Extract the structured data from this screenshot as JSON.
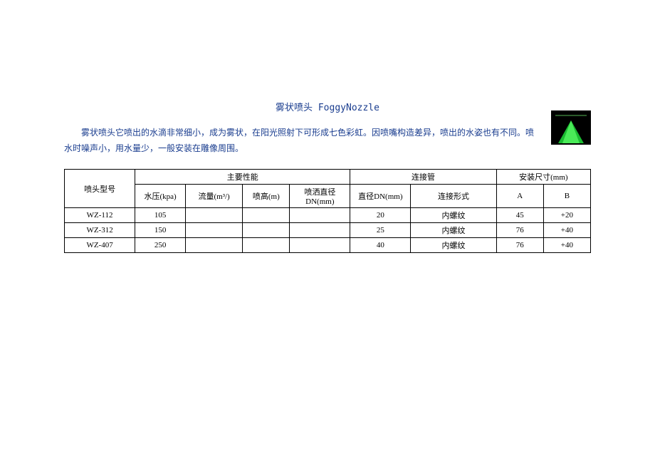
{
  "title": "雾状喷头 FoggyNozzle",
  "description": "雾状喷头它喷出的水滴非常细小，成为雾状，在阳光照射下可形成七色彩虹。因喷嘴构造差异，喷出的水姿也有不同。喷水时噪声小，用水量少，一般安装在雕像周围。",
  "thumb_alt": "foggy-nozzle-spray",
  "table": {
    "header": {
      "model": "喷头型号",
      "perf": "主要性能",
      "pipe": "连接管",
      "size": "安装尺寸(mm)",
      "kpa": "水压(kpa)",
      "flow": "流量(m³/)",
      "ph": "喷高(m)",
      "dn": "喷洒直径DN(mm)",
      "dia": "直径DN(mm)",
      "conn": "连接形式",
      "a": "A",
      "b": "B"
    },
    "rows": [
      {
        "model": "WZ-112",
        "kpa": "105",
        "flow": "",
        "ph": "",
        "dn": "",
        "dia": "20",
        "conn": "内螺纹",
        "a": "45",
        "b": "+20"
      },
      {
        "model": "WZ-312",
        "kpa": "150",
        "flow": "",
        "ph": "",
        "dn": "",
        "dia": "25",
        "conn": "内螺纹",
        "a": "76",
        "b": "+40"
      },
      {
        "model": "WZ-407",
        "kpa": "250",
        "flow": "",
        "ph": "",
        "dn": "",
        "dia": "40",
        "conn": "内螺纹",
        "a": "76",
        "b": "+40"
      }
    ]
  }
}
